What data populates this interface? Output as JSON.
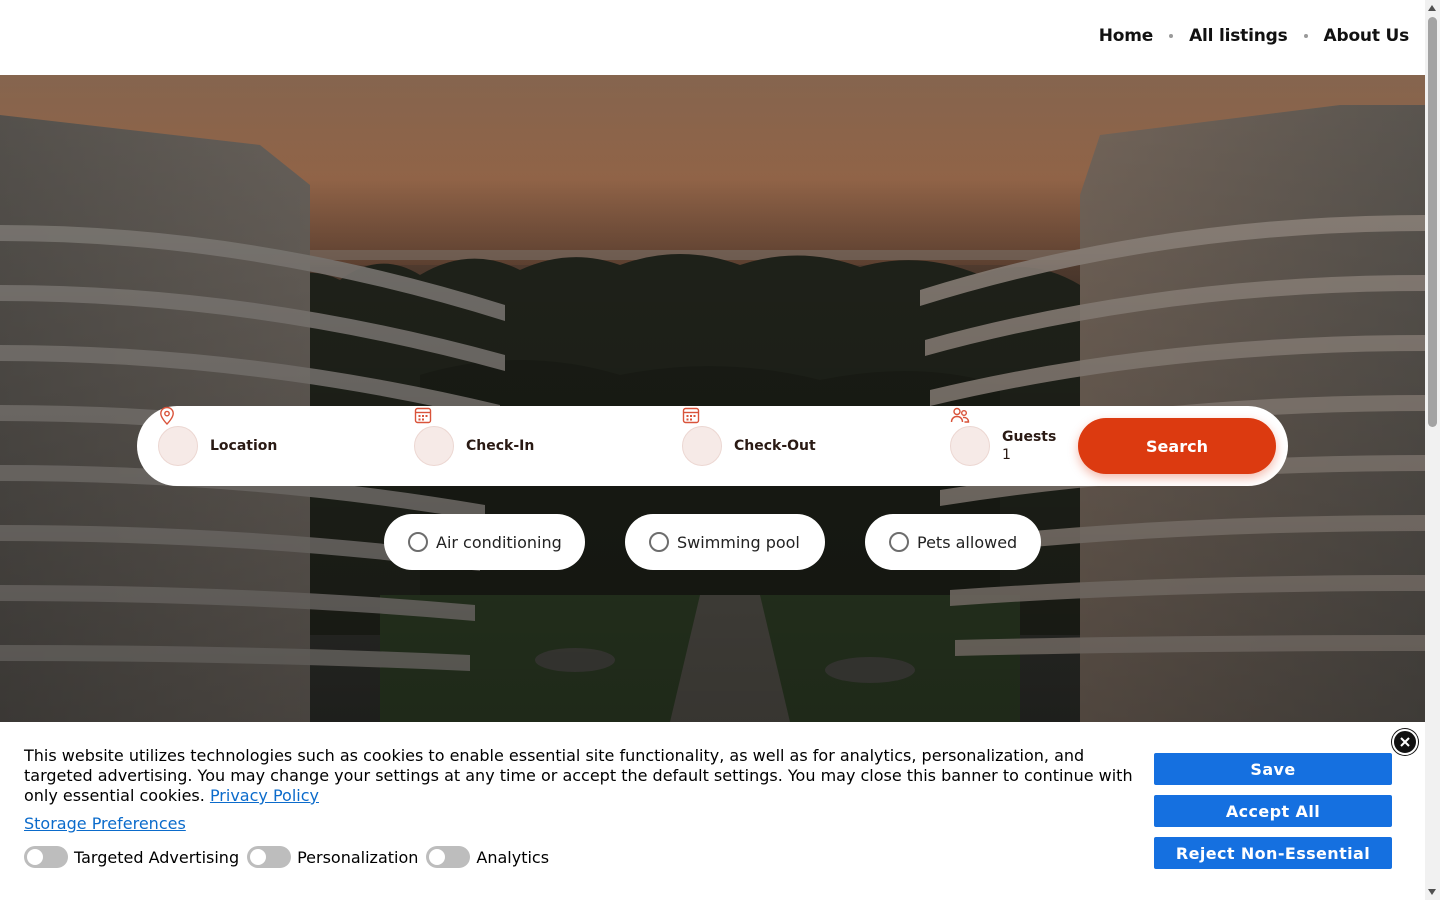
{
  "nav": {
    "items": [
      {
        "label": "Home"
      },
      {
        "label": "All listings"
      },
      {
        "label": "About Us"
      }
    ]
  },
  "search": {
    "location_label": "Location",
    "checkin_label": "Check-In",
    "checkout_label": "Check-Out",
    "guests_label": "Guests",
    "guests_value": "1",
    "button_label": "Search"
  },
  "amenities": [
    {
      "label": "Air conditioning",
      "checked": false
    },
    {
      "label": "Swimming pool",
      "checked": false
    },
    {
      "label": "Pets allowed",
      "checked": false
    }
  ],
  "cookie": {
    "text": "This website utilizes technologies such as cookies to enable essential site functionality, as well as for analytics, personalization, and targeted advertising. You may change your settings at any time or accept the default settings. You may close this banner to continue with only essential cookies.",
    "privacy_link": "Privacy Policy",
    "storage_link": "Storage Preferences",
    "toggles": [
      {
        "label": "Targeted Advertising",
        "on": false
      },
      {
        "label": "Personalization",
        "on": false
      },
      {
        "label": "Analytics",
        "on": false
      }
    ],
    "buttons": {
      "save": "Save",
      "accept_all": "Accept All",
      "reject": "Reject Non-Essential"
    }
  },
  "colors": {
    "accent": "#dc3a10",
    "cookie_button": "#1570e0",
    "link": "#0b6bcb"
  },
  "icons": {
    "location": "map-pin-icon",
    "checkin": "calendar-icon",
    "checkout": "calendar-icon",
    "guests": "users-icon",
    "close": "close-icon"
  }
}
